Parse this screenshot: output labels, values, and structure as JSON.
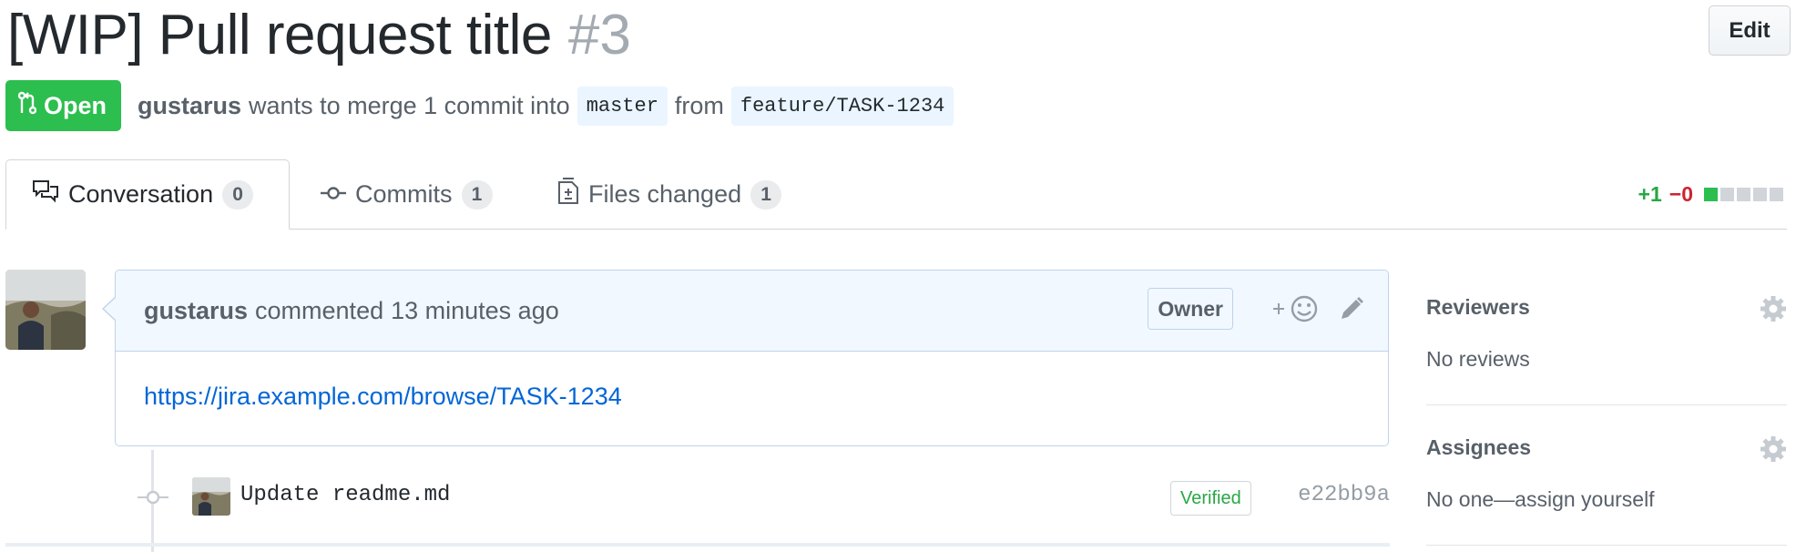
{
  "header": {
    "title": "[WIP] Pull request title",
    "number": "#3",
    "edit_label": "Edit"
  },
  "state": {
    "label": "Open",
    "color": "#2cbe4e"
  },
  "meta": {
    "author": "gustarus",
    "text_before": "wants to merge 1 commit into",
    "base_branch": "master",
    "text_from": "from",
    "head_branch": "feature/TASK-1234"
  },
  "tabs": [
    {
      "label": "Conversation",
      "count": "0",
      "icon": "comment-discussion-icon",
      "selected": true
    },
    {
      "label": "Commits",
      "count": "1",
      "icon": "git-commit-icon",
      "selected": false
    },
    {
      "label": "Files changed",
      "count": "1",
      "icon": "file-diff-icon",
      "selected": false
    }
  ],
  "diffstat": {
    "additions": "+1",
    "deletions": "−0",
    "blocks_green": 1,
    "blocks_total": 5
  },
  "comment": {
    "author": "gustarus",
    "action": "commented",
    "time": "13 minutes ago",
    "role_badge": "Owner",
    "body_link": "https://jira.example.com/browse/TASK-1234",
    "reaction_icon": "smiley-icon",
    "edit_icon": "pencil-icon"
  },
  "commit": {
    "message": "Update readme.md",
    "verified_label": "Verified",
    "sha": "e22bb9a"
  },
  "sidebar": {
    "reviewers": {
      "heading": "Reviewers",
      "value": "No reviews"
    },
    "assignees": {
      "heading": "Assignees",
      "value": "No one—assign yourself"
    }
  },
  "colors": {
    "link": "#0366d6",
    "additions": "#28a745",
    "deletions": "#cb2431",
    "comment_header_bg": "#f1f8ff"
  }
}
